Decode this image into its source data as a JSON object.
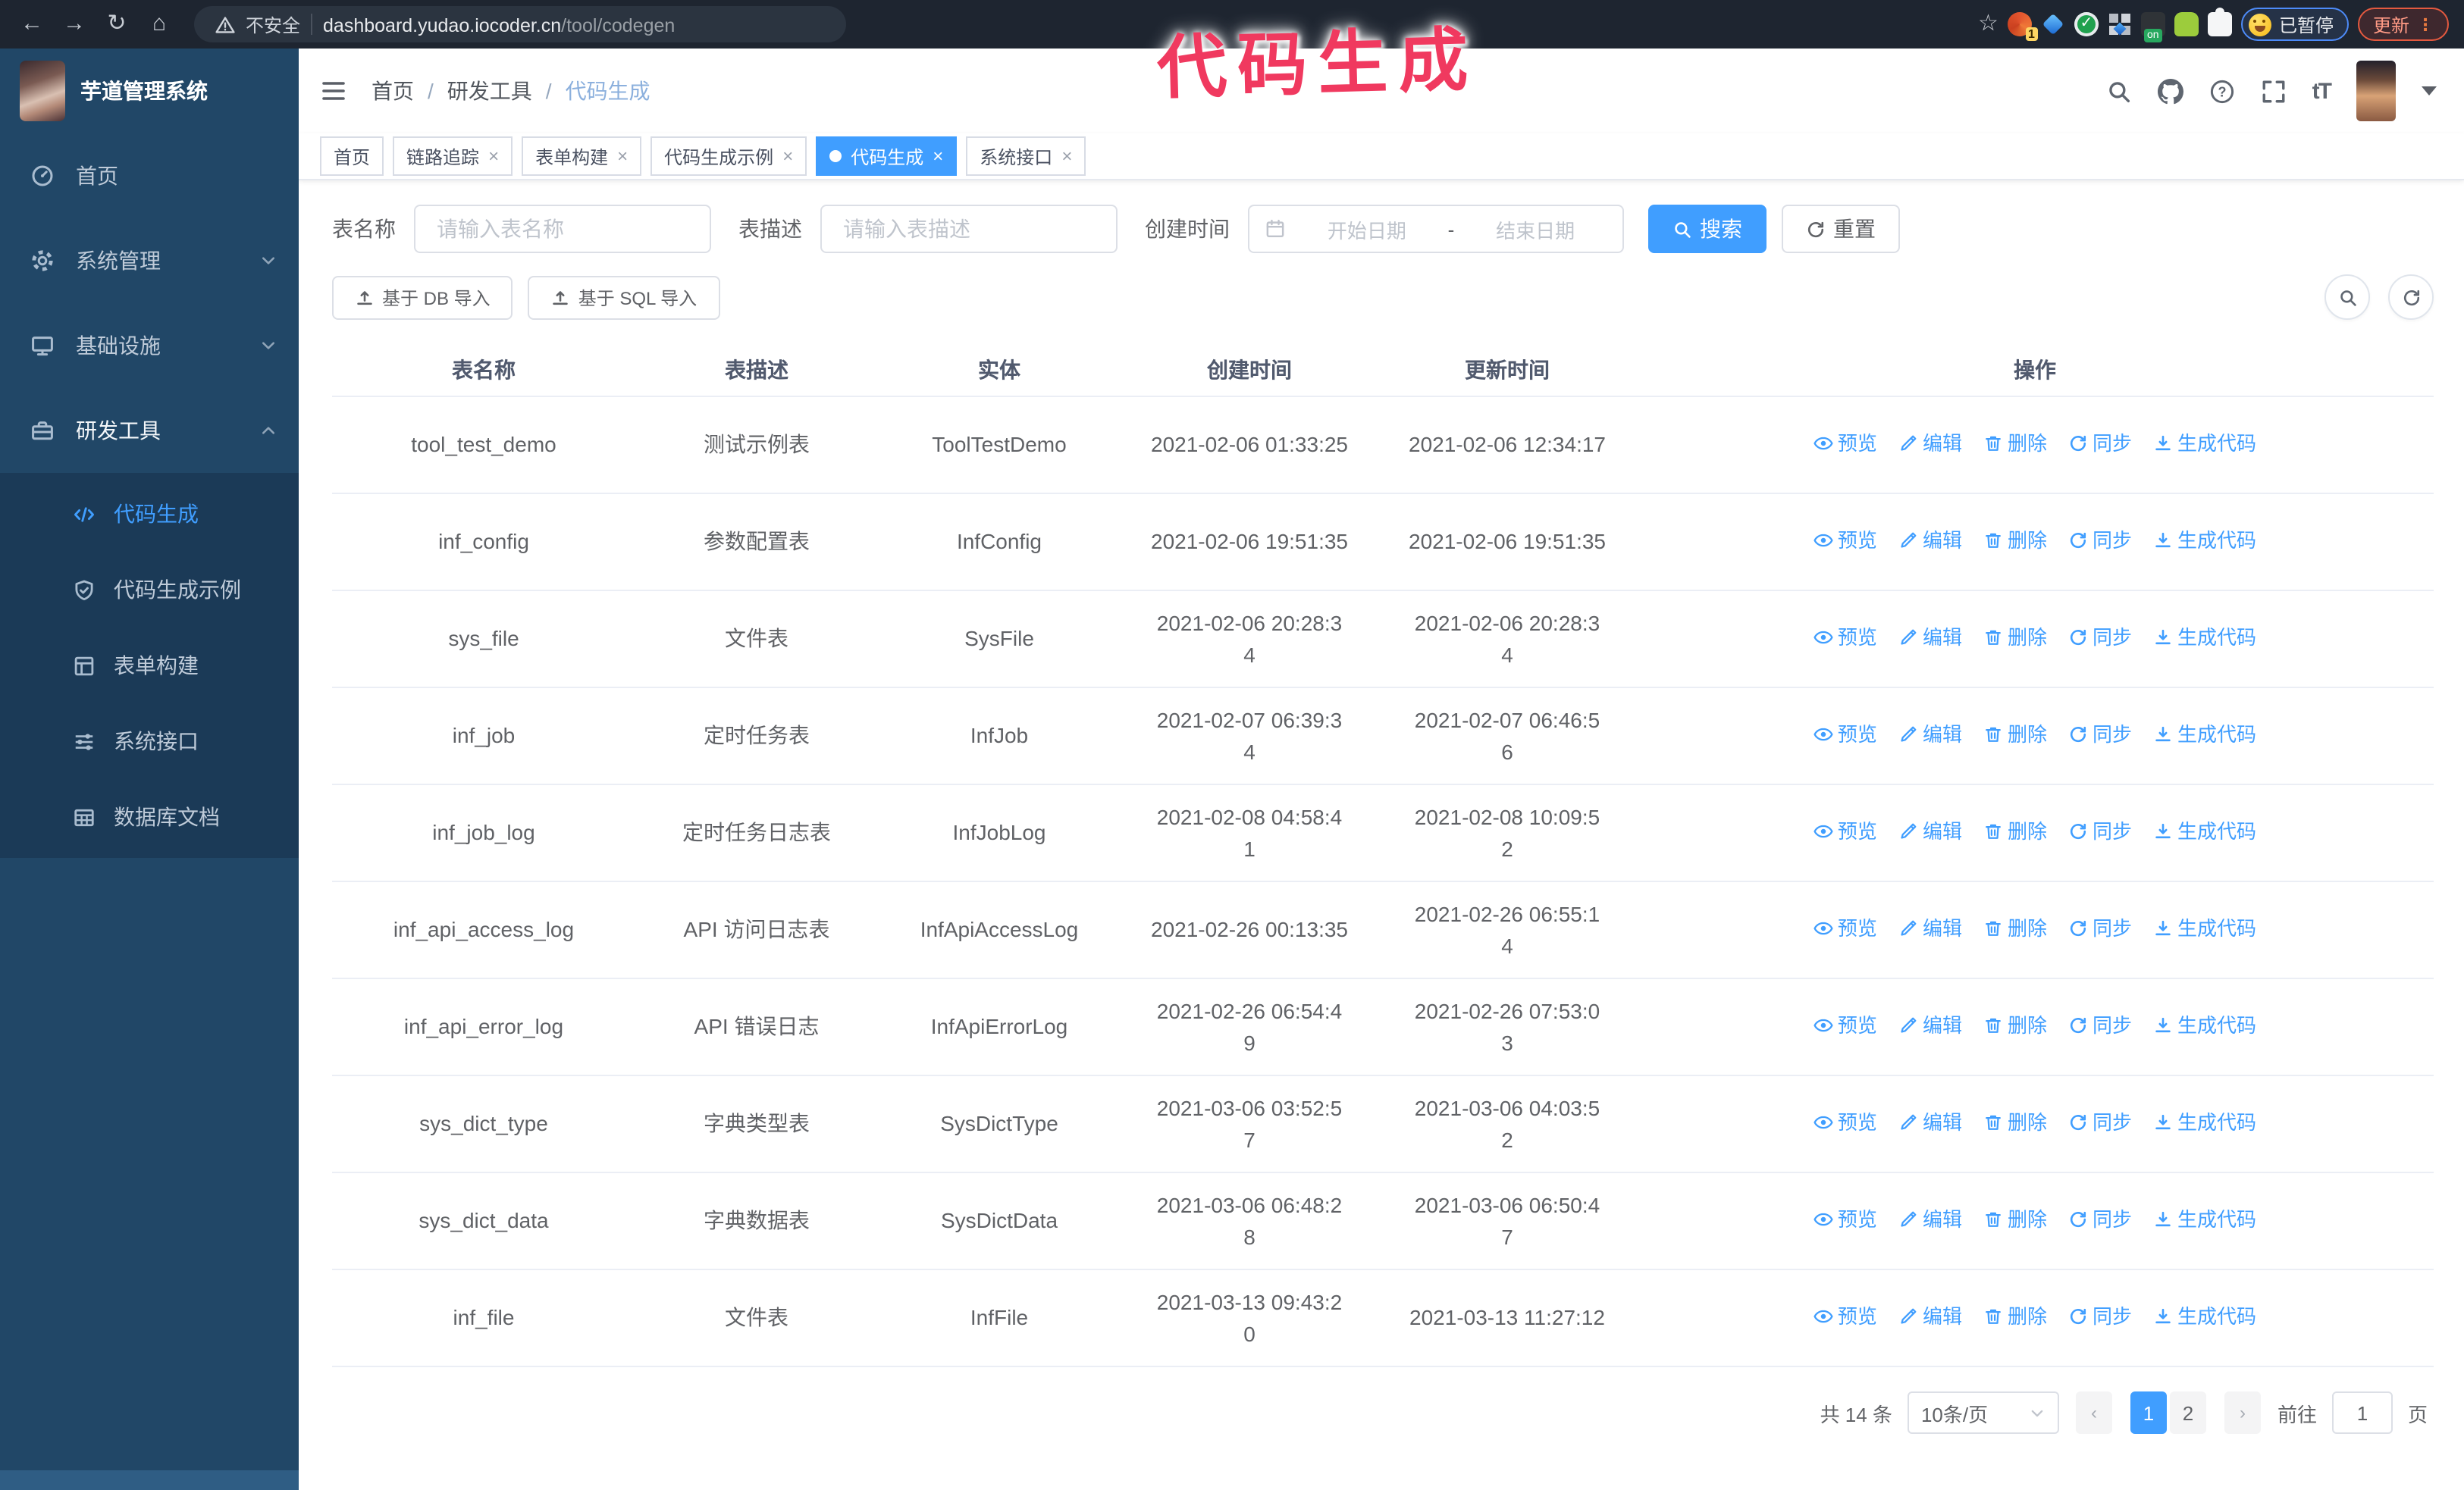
{
  "browser": {
    "security_label": "不安全",
    "url_host": "dashboard.yudao.iocoder.cn",
    "url_path": "/tool/codegen",
    "extension_badge_1": "1",
    "extension_badge_on": "on",
    "paused_badge": "已暂停",
    "update_button": "更新"
  },
  "annotation": {
    "watermark": "代码生成",
    "color": "#f0395f"
  },
  "sidebar": {
    "title": "芋道管理系统",
    "menu": [
      {
        "label": "首页",
        "icon": "dashboard-icon"
      },
      {
        "label": "系统管理",
        "icon": "gear-icon",
        "arrow": "down"
      },
      {
        "label": "基础设施",
        "icon": "monitor-icon",
        "arrow": "down"
      },
      {
        "label": "研发工具",
        "icon": "toolbox-icon",
        "arrow": "up",
        "active": true
      }
    ],
    "submenu": [
      {
        "label": "代码生成",
        "icon": "code-icon",
        "active": true
      },
      {
        "label": "代码生成示例",
        "icon": "shield-icon"
      },
      {
        "label": "表单构建",
        "icon": "form-icon"
      },
      {
        "label": "系统接口",
        "icon": "sliders-icon"
      },
      {
        "label": "数据库文档",
        "icon": "table-grid-icon"
      }
    ]
  },
  "navbar": {
    "breadcrumb": [
      "首页",
      "研发工具",
      "代码生成"
    ],
    "separator": "/"
  },
  "tabs": [
    {
      "label": "首页",
      "closable": false
    },
    {
      "label": "链路追踪",
      "closable": true
    },
    {
      "label": "表单构建",
      "closable": true
    },
    {
      "label": "代码生成示例",
      "closable": true
    },
    {
      "label": "代码生成",
      "closable": true,
      "active": true
    },
    {
      "label": "系统接口",
      "closable": true
    }
  ],
  "filters": {
    "table_name_label": "表名称",
    "table_name_placeholder": "请输入表名称",
    "table_desc_label": "表描述",
    "table_desc_placeholder": "请输入表描述",
    "create_time_label": "创建时间",
    "start_date_placeholder": "开始日期",
    "range_separator": "-",
    "end_date_placeholder": "结束日期",
    "search_label": "搜索",
    "reset_label": "重置"
  },
  "toolbar": {
    "import_db_label": "基于 DB 导入",
    "import_sql_label": "基于 SQL 导入"
  },
  "table": {
    "columns": [
      "表名称",
      "表描述",
      "实体",
      "创建时间",
      "更新时间",
      "操作"
    ],
    "actions": [
      {
        "icon": "eye-icon",
        "label": "预览"
      },
      {
        "icon": "edit-icon",
        "label": "编辑"
      },
      {
        "icon": "delete-icon",
        "label": "删除"
      },
      {
        "icon": "sync-icon",
        "label": "同步"
      },
      {
        "icon": "download-icon",
        "label": "生成代码"
      }
    ],
    "rows": [
      {
        "name": "tool_test_demo",
        "description": "测试示例表",
        "entity": "ToolTestDemo",
        "create_time": "2021-02-06 01:33:25",
        "update_time": "2021-02-06 12:34:17"
      },
      {
        "name": "inf_config",
        "description": "参数配置表",
        "entity": "InfConfig",
        "create_time": "2021-02-06 19:51:35",
        "update_time": "2021-02-06 19:51:35"
      },
      {
        "name": "sys_file",
        "description": "文件表",
        "entity": "SysFile",
        "create_time": "2021-02-06 20:28:3\n4",
        "update_time": "2021-02-06 20:28:3\n4"
      },
      {
        "name": "inf_job",
        "description": "定时任务表",
        "entity": "InfJob",
        "create_time": "2021-02-07 06:39:3\n4",
        "update_time": "2021-02-07 06:46:5\n6"
      },
      {
        "name": "inf_job_log",
        "description": "定时任务日志表",
        "entity": "InfJobLog",
        "create_time": "2021-02-08 04:58:4\n1",
        "update_time": "2021-02-08 10:09:5\n2"
      },
      {
        "name": "inf_api_access_log",
        "description": "API 访问日志表",
        "entity": "InfApiAccessLog",
        "create_time": "2021-02-26 00:13:35",
        "update_time": "2021-02-26 06:55:1\n4"
      },
      {
        "name": "inf_api_error_log",
        "description": "API 错误日志",
        "entity": "InfApiErrorLog",
        "create_time": "2021-02-26 06:54:4\n9",
        "update_time": "2021-02-26 07:53:0\n3"
      },
      {
        "name": "sys_dict_type",
        "description": "字典类型表",
        "entity": "SysDictType",
        "create_time": "2021-03-06 03:52:5\n7",
        "update_time": "2021-03-06 04:03:5\n2"
      },
      {
        "name": "sys_dict_data",
        "description": "字典数据表",
        "entity": "SysDictData",
        "create_time": "2021-03-06 06:48:2\n8",
        "update_time": "2021-03-06 06:50:4\n7"
      },
      {
        "name": "inf_file",
        "description": "文件表",
        "entity": "InfFile",
        "create_time": "2021-03-13 09:43:2\n0",
        "update_time": "2021-03-13 11:27:12"
      }
    ]
  },
  "pagination": {
    "total_text": "共 14 条",
    "page_size_text": "10条/页",
    "prev_label": "‹",
    "next_label": "›",
    "pages": [
      {
        "label": "1",
        "active": true
      },
      {
        "label": "2"
      }
    ],
    "goto_label": "前往",
    "goto_value": "1",
    "goto_suffix": "页"
  },
  "colors": {
    "primary": "#409eff",
    "sidebar_bg": "#214767",
    "submenu_bg": "#1b3a57",
    "annotation": "#f0395f"
  }
}
